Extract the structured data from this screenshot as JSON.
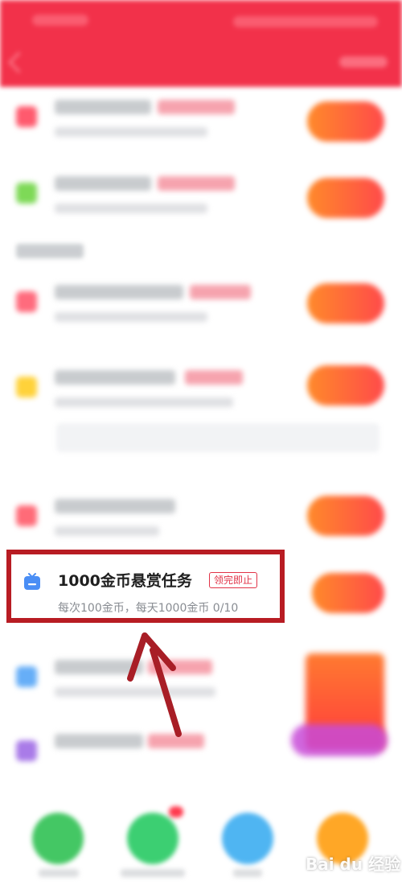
{
  "highlighted_task": {
    "title": "1000金币悬赏任务",
    "tag": "领完即止",
    "subtitle": "每次100金币，每天1000金币 0/10",
    "icon": "tv-icon",
    "icon_color": "#4a8ef5"
  },
  "colors": {
    "header": "#f2314a",
    "annotation_red": "#b81c23",
    "button_gradient_start": "#ff8a2a",
    "button_gradient_end": "#ff4a4a"
  },
  "watermark": "Bai du 经验"
}
